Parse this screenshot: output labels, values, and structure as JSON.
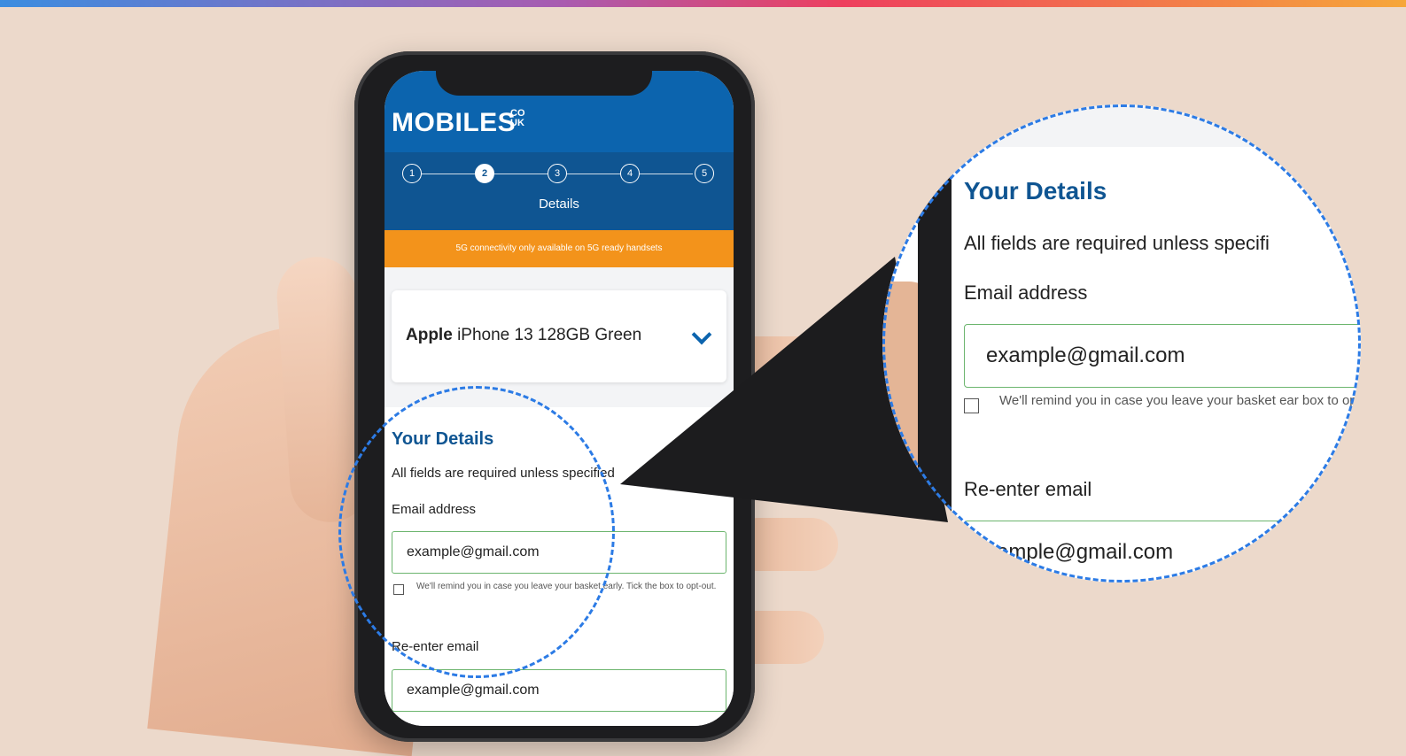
{
  "brand": {
    "name": "MOBILES",
    "suffix": "CO\nUK"
  },
  "steps": [
    "1",
    "2",
    "3",
    "4",
    "5"
  ],
  "active_step": 2,
  "step_label": "Details",
  "promo": "5G connectivity only available on 5G ready handsets",
  "product": {
    "brand": "Apple",
    "model": "iPhone 13 128GB Green"
  },
  "details": {
    "title": "Your Details",
    "subtitle": "All fields are required unless specified",
    "email_label": "Email address",
    "email_value": "example@gmail.com",
    "remind_text": "We'll remind you in case you leave your basket early. Tick the box to opt-out.",
    "reenter_label": "Re-enter email",
    "reenter_value": "example@gmail.com"
  },
  "zoom": {
    "title": "Your Details",
    "subtitle": "All fields are required unless specifi",
    "email_label": "Email address",
    "email_value": "example@gmail.com",
    "remind_text": "We'll remind you in case you leave your basket ear box to opt-out.",
    "reenter_label": "Re-enter email",
    "reenter_value": "xample@gmail.com"
  },
  "colors": {
    "brand_blue": "#0c64ae",
    "step_blue": "#0f5592",
    "promo_orange": "#f3931b",
    "field_green": "#6cb56e",
    "highlight_dash": "#2c7be5",
    "background": "#ecd9cb"
  },
  "icons": {
    "expand": "chevron-down-icon",
    "checkbox": "checkbox-icon"
  }
}
